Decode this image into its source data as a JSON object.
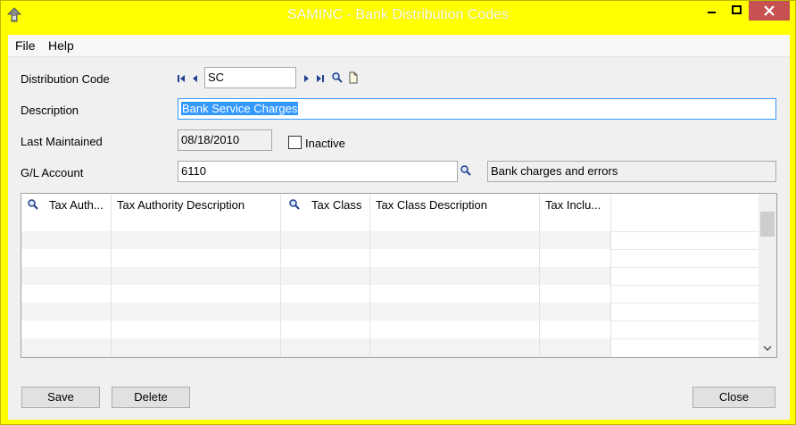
{
  "window": {
    "title": "SAMINC - Bank Distribution Codes"
  },
  "menu": {
    "file": "File",
    "help": "Help"
  },
  "form": {
    "distribution_code_label": "Distribution Code",
    "distribution_code_value": "SC",
    "description_label": "Description",
    "description_value": "Bank Service Charges",
    "last_maintained_label": "Last Maintained",
    "last_maintained_value": "08/18/2010",
    "inactive_label": "Inactive",
    "inactive_checked": false,
    "gl_account_label": "G/L Account",
    "gl_account_value": "6110",
    "gl_account_description": "Bank charges and errors"
  },
  "grid": {
    "columns": [
      "Tax Auth...",
      "Tax Authority Description",
      "Tax Class",
      "Tax Class Description",
      "Tax Inclu..."
    ],
    "rows": []
  },
  "buttons": {
    "save": "Save",
    "delete": "Delete",
    "close": "Close"
  },
  "colors": {
    "titlebar": "#ffff00",
    "close_button": "#c75050",
    "selection": "#3399ff"
  },
  "icons": [
    "app-icon",
    "first-record-icon",
    "previous-record-icon",
    "next-record-icon",
    "last-record-icon",
    "finder-icon",
    "new-document-icon",
    "minimize-icon",
    "maximize-icon",
    "close-icon"
  ]
}
